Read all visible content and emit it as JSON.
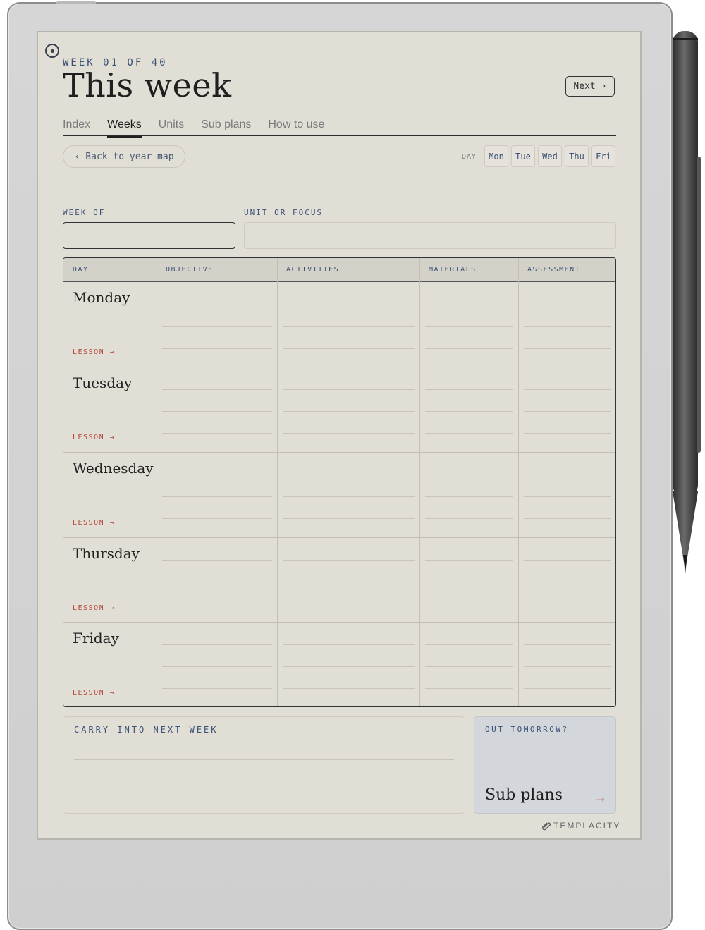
{
  "header": {
    "eyebrow": "WEEK 01 OF 40",
    "title": "This week",
    "next_label": "Next",
    "next_chevron": "›"
  },
  "tabs": [
    {
      "label": "Index",
      "active": false
    },
    {
      "label": "Weeks",
      "active": true
    },
    {
      "label": "Units",
      "active": false
    },
    {
      "label": "Sub plans",
      "active": false
    },
    {
      "label": "How to use",
      "active": false
    }
  ],
  "nav": {
    "back_chevron": "‹",
    "back_label": "Back to year map",
    "day_label": "DAY",
    "days": [
      "Mon",
      "Tue",
      "Wed",
      "Thu",
      "Fri"
    ]
  },
  "fields": {
    "week_of_label": "WEEK OF",
    "week_of_value": "",
    "unit_label": "UNIT OR FOCUS",
    "unit_value": ""
  },
  "table": {
    "headers": [
      "DAY",
      "OBJECTIVE",
      "ACTIVITIES",
      "MATERIALS",
      "ASSESSMENT"
    ],
    "rows": [
      {
        "day": "Monday",
        "lesson": "LESSON →"
      },
      {
        "day": "Tuesday",
        "lesson": "LESSON →"
      },
      {
        "day": "Wednesday",
        "lesson": "LESSON →"
      },
      {
        "day": "Thursday",
        "lesson": "LESSON →"
      },
      {
        "day": "Friday",
        "lesson": "LESSON →"
      }
    ]
  },
  "carry": {
    "label": "CARRY INTO NEXT WEEK"
  },
  "out": {
    "label": "OUT TOMORROW?",
    "link_label": "Sub plans",
    "arrow": "→"
  },
  "brand": {
    "name": "TEMPLACITY",
    "icon": "paperclip-icon"
  },
  "colors": {
    "accent_blue": "#3b5277",
    "lesson_red": "#b5473a",
    "paper": "#e1ded6"
  }
}
